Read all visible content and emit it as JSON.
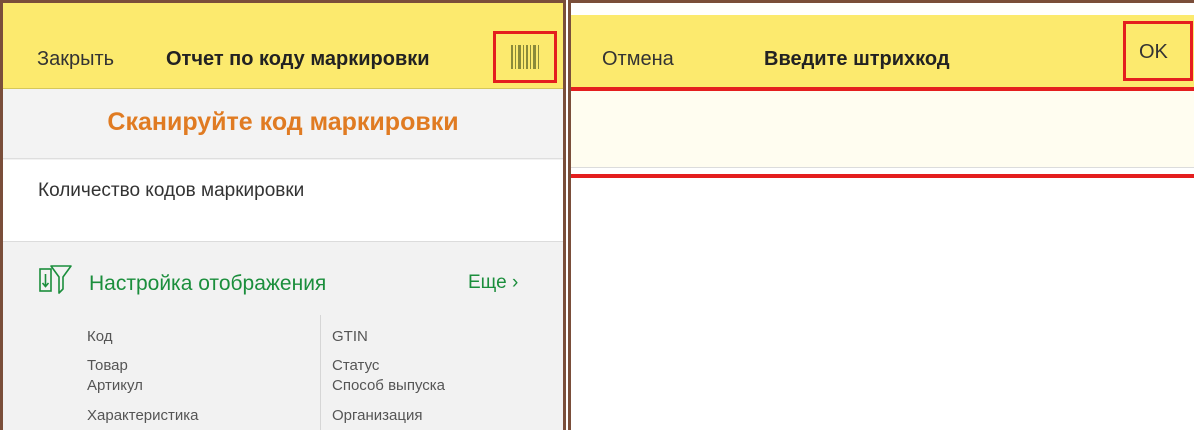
{
  "left": {
    "header": {
      "close_label": "Закрыть",
      "title": "Отчет по коду маркировки",
      "barcode_icon": "barcode-icon"
    },
    "scan_prompt": "Сканируйте код маркировки",
    "count_label": "Количество кодов маркировки",
    "settings": {
      "label": "Настройка отображения",
      "more_label": "Еще ›",
      "icon": "filter-settings-icon"
    },
    "fields_left": [
      "Код",
      "Товар",
      "Артикул",
      "Характеристика"
    ],
    "fields_right": [
      "GTIN",
      "Статус",
      "Способ выпуска",
      "Организация"
    ]
  },
  "right": {
    "header": {
      "cancel_label": "Отмена",
      "title": "Введите штрихкод",
      "ok_label": "OK"
    },
    "barcode_input": {
      "value": "",
      "placeholder": ""
    }
  },
  "colors": {
    "header_bg": "#fcea6e",
    "accent_orange": "#e07b22",
    "link_green": "#1b8e3c",
    "highlight_red": "#e41e1e",
    "frame_brown": "#7a4e3a"
  }
}
